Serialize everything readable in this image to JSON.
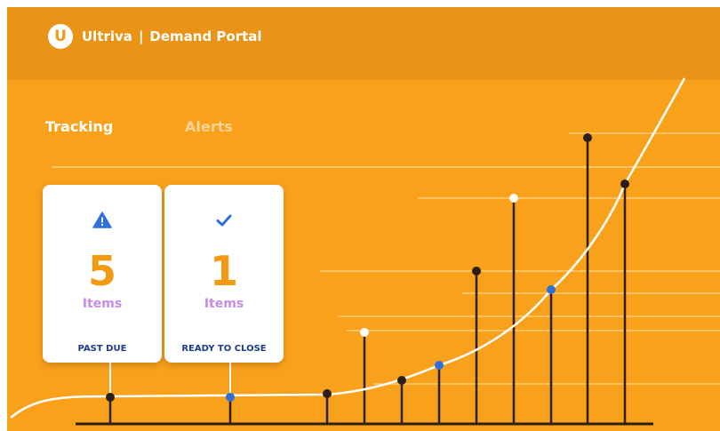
{
  "header": {
    "logo_letter": "U",
    "brand": "Ultriva",
    "separator": "|",
    "product": "Demand Portal"
  },
  "tabs": [
    {
      "label": "Tracking",
      "active": true
    },
    {
      "label": "Alerts",
      "active": false
    }
  ],
  "cards": [
    {
      "icon": "warning-icon",
      "count": "5",
      "unit": "Items",
      "status": "PAST DUE"
    },
    {
      "icon": "check-icon",
      "count": "1",
      "unit": "Items",
      "status": "READY TO CLOSE"
    }
  ],
  "colors": {
    "background": "#F9A11B",
    "header": "#E99417",
    "count": "#F39A12",
    "unit": "#C58BE6",
    "status": "#1E3C8C",
    "accent_blue": "#2F6FD8",
    "stem": "#2A2017"
  }
}
